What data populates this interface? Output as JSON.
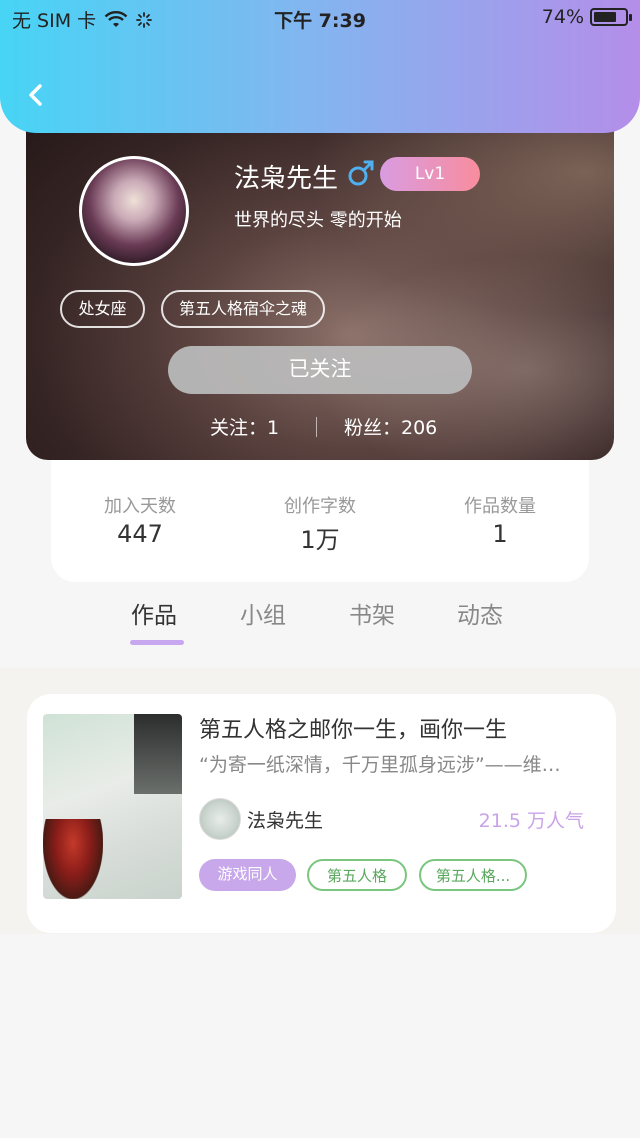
{
  "status_bar": {
    "carrier": "无 SIM 卡",
    "time": "下午 7:39",
    "battery": "74%",
    "battery_level": 0.74
  },
  "profile": {
    "username": "法枭先生",
    "gender_icon": "male-icon",
    "level": "Lv1",
    "signature": "世界的尽头   零的开始",
    "tags": [
      "处女座",
      "第五人格宿伞之魂"
    ],
    "follow_button": "已关注",
    "following_label": "关注：1",
    "fans_label": "粉丝：206"
  },
  "stats": [
    {
      "label": "加入天数",
      "value": "447"
    },
    {
      "label": "创作字数",
      "value": "1万"
    },
    {
      "label": "作品数量",
      "value": "1"
    }
  ],
  "tabs": [
    "作品",
    "小组",
    "书架",
    "动态"
  ],
  "active_tab": "作品",
  "work": {
    "title": "第五人格之邮你一生，画你一生",
    "description": "“为寄一纸深情，千万里孤身远涉”——维…",
    "author": "法枭先生",
    "popularity": "21.5 万人气",
    "tags": [
      "游戏同人",
      "第五人格",
      "第五人格..."
    ]
  },
  "colors": {
    "header_gradient_start": "#47d4f5",
    "header_gradient_end": "#b48ee9",
    "accent_purple": "#c7a7ef",
    "tag_green": "#7bc67e",
    "popularity": "#c9a3e8"
  }
}
